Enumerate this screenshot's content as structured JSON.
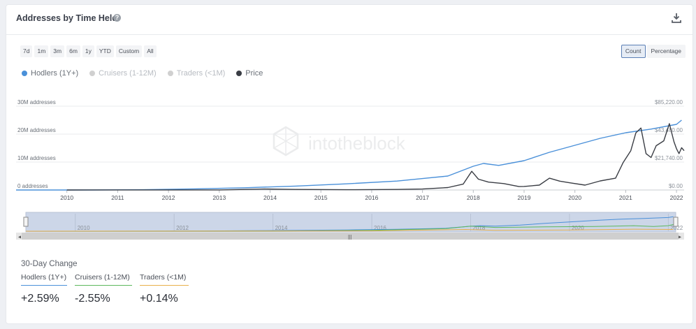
{
  "header": {
    "title": "Addresses by Time Held",
    "help_icon": "?"
  },
  "ranges": [
    "7d",
    "1m",
    "3m",
    "6m",
    "1y",
    "YTD",
    "Custom",
    "All"
  ],
  "modes": [
    {
      "label": "Count",
      "active": true
    },
    {
      "label": "Percentage",
      "active": false
    }
  ],
  "legend": [
    {
      "label": "Hodlers (1Y+)",
      "color": "#4a90d9",
      "active": true
    },
    {
      "label": "Cruisers (1-12M)",
      "color": "#c8c8c8",
      "active": false
    },
    {
      "label": "Traders (<1M)",
      "color": "#c8c8c8",
      "active": false
    },
    {
      "label": "Price",
      "color": "#3a3d44",
      "active": true
    }
  ],
  "watermark": "intotheblock",
  "navigator": {
    "years": [
      "2010",
      "2012",
      "2014",
      "2016",
      "2018",
      "2020",
      "2022"
    ]
  },
  "change": {
    "title": "30-Day Change",
    "items": [
      {
        "label": "Hodlers (1Y+)",
        "value": "+2.59%",
        "color": "#4a90d9"
      },
      {
        "label": "Cruisers (1-12M)",
        "value": "-2.55%",
        "color": "#5cb85c"
      },
      {
        "label": "Traders (<1M)",
        "value": "+0.14%",
        "color": "#e8b04a"
      }
    ]
  },
  "chart_data": {
    "type": "line",
    "x_tick_labels": [
      "2010",
      "2011",
      "2012",
      "2013",
      "2014",
      "2015",
      "2016",
      "2017",
      "2018",
      "2019",
      "2020",
      "2021",
      "2022"
    ],
    "y_left_ticks": [
      "0 addresses",
      "10M addresses",
      "20M addresses",
      "30M addresses"
    ],
    "y_right_ticks": [
      "$0.00",
      "$21,740.00",
      "$43,480.00",
      "$85,220.00"
    ],
    "ylim_left": [
      0,
      30000000
    ],
    "ylim_right": [
      0,
      85220
    ],
    "grid": true,
    "legend_position": "top-left",
    "series": [
      {
        "name": "Hodlers (1Y+)",
        "axis": "left",
        "color": "#4a90d9",
        "points": [
          [
            2009.0,
            0
          ],
          [
            2010.5,
            10000
          ],
          [
            2011.5,
            100000
          ],
          [
            2012.5,
            400000
          ],
          [
            2013.5,
            800000
          ],
          [
            2014.5,
            1400000
          ],
          [
            2015.5,
            2200000
          ],
          [
            2016.5,
            3200000
          ],
          [
            2017.5,
            5000000
          ],
          [
            2018.0,
            8500000
          ],
          [
            2018.2,
            9500000
          ],
          [
            2018.5,
            8800000
          ],
          [
            2019.0,
            10500000
          ],
          [
            2019.5,
            13500000
          ],
          [
            2020.0,
            16000000
          ],
          [
            2020.5,
            18500000
          ],
          [
            2021.0,
            20500000
          ],
          [
            2021.5,
            21800000
          ],
          [
            2022.0,
            23500000
          ],
          [
            2022.1,
            25000000
          ]
        ]
      },
      {
        "name": "Price",
        "axis": "right",
        "color": "#3a3d44",
        "points": [
          [
            2010.0,
            0
          ],
          [
            2013.0,
            100
          ],
          [
            2013.9,
            1000
          ],
          [
            2014.5,
            600
          ],
          [
            2015.5,
            250
          ],
          [
            2016.5,
            600
          ],
          [
            2017.0,
            1000
          ],
          [
            2017.5,
            2500
          ],
          [
            2017.8,
            6000
          ],
          [
            2017.97,
            19000
          ],
          [
            2018.1,
            11000
          ],
          [
            2018.3,
            8000
          ],
          [
            2018.6,
            6500
          ],
          [
            2018.9,
            3500
          ],
          [
            2019.0,
            3600
          ],
          [
            2019.3,
            5000
          ],
          [
            2019.5,
            12000
          ],
          [
            2019.7,
            9000
          ],
          [
            2019.9,
            7300
          ],
          [
            2020.2,
            5000
          ],
          [
            2020.5,
            9200
          ],
          [
            2020.8,
            12000
          ],
          [
            2020.95,
            28000
          ],
          [
            2021.1,
            40000
          ],
          [
            2021.2,
            58000
          ],
          [
            2021.3,
            63000
          ],
          [
            2021.4,
            37000
          ],
          [
            2021.5,
            33000
          ],
          [
            2021.6,
            45000
          ],
          [
            2021.75,
            50000
          ],
          [
            2021.86,
            67500
          ],
          [
            2021.95,
            49000
          ],
          [
            2022.0,
            42000
          ],
          [
            2022.05,
            37000
          ],
          [
            2022.1,
            43000
          ],
          [
            2022.15,
            40000
          ]
        ]
      }
    ]
  }
}
